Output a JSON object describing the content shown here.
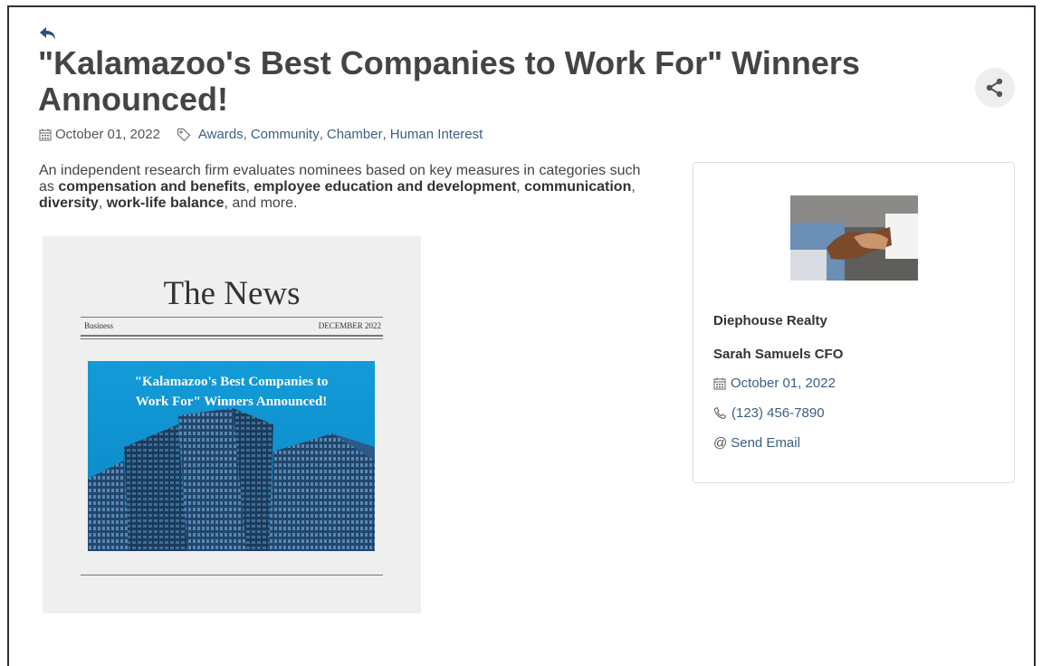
{
  "article": {
    "title": "\"Kalamazoo's Best Companies to Work For\" Winners Announced!",
    "date": "October 01, 2022",
    "categories": [
      "Awards",
      "Community",
      "Chamber",
      "Human Interest"
    ],
    "intro": {
      "t1": "An independent research firm evaluates nominees based on key measures in categories such as ",
      "b1": "compensation and benefits",
      "t2": ", ",
      "b2": "employee education and development",
      "t3": ", ",
      "b3": "communication",
      "t4": ", ",
      "b4": "diversity",
      "t5": ", ",
      "b5": "work-life balance",
      "t6": ", and more."
    }
  },
  "image": {
    "masthead": "The News",
    "section": "Business",
    "issue": "DECEMBER 2022",
    "caption_line1": "\"Kalamazoo's Best Companies to",
    "caption_line2": "Work For\" Winners Announced!"
  },
  "sidebar": {
    "company": "Diephouse Realty",
    "contact": "Sarah Samuels CFO",
    "date": "October 01, 2022",
    "phone": "(123) 456-7890",
    "email_prefix": "@",
    "email_label": "Send Email"
  },
  "icons": [
    "back-arrow-icon",
    "share-icon",
    "calendar-icon",
    "tag-icon",
    "phone-icon"
  ],
  "colors": {
    "link": "#3c5f86",
    "title": "#444444",
    "frame": "#2b2f3a"
  }
}
